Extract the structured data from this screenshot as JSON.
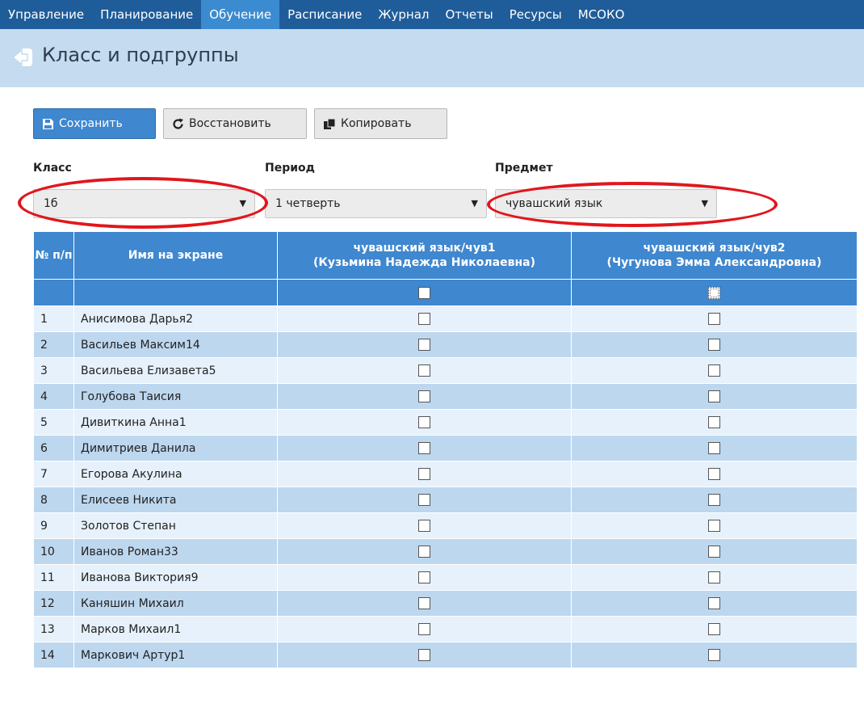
{
  "nav": {
    "items": [
      {
        "label": "Управление"
      },
      {
        "label": "Планирование"
      },
      {
        "label": "Обучение",
        "active": true
      },
      {
        "label": "Расписание"
      },
      {
        "label": "Журнал"
      },
      {
        "label": "Отчеты"
      },
      {
        "label": "Ресурсы"
      },
      {
        "label": "МСОКО"
      }
    ]
  },
  "header": {
    "title": "Класс и подгруппы",
    "back_icon": "arrow-left-icon"
  },
  "toolbar": {
    "save_label": "Сохранить",
    "restore_label": "Восстановить",
    "copy_label": "Копировать"
  },
  "filters": {
    "class": {
      "label": "Класс",
      "value": "1б"
    },
    "period": {
      "label": "Период",
      "value": "1 четверть"
    },
    "subject": {
      "label": "Предмет",
      "value": "чувашский язык"
    }
  },
  "table": {
    "col_num": "№ п/п",
    "col_name": "Имя на экране",
    "groups": [
      {
        "line1": "чувашский язык/чув1",
        "line2": "(Кузьмина Надежда Николаевна)"
      },
      {
        "line1": "чувашский язык/чув2",
        "line2": "(Чугунова Эмма Александровна)"
      }
    ],
    "rows": [
      {
        "num": "1",
        "name": "Анисимова Дарья2"
      },
      {
        "num": "2",
        "name": "Васильев Максим14"
      },
      {
        "num": "3",
        "name": "Васильева Елизавета5"
      },
      {
        "num": "4",
        "name": "Голубова Таисия"
      },
      {
        "num": "5",
        "name": "Дивиткина Анна1"
      },
      {
        "num": "6",
        "name": "Димитриев Данила"
      },
      {
        "num": "7",
        "name": "Егорова Акулина"
      },
      {
        "num": "8",
        "name": "Елисеев Никита"
      },
      {
        "num": "9",
        "name": "Золотов Степан"
      },
      {
        "num": "10",
        "name": "Иванов Роман33"
      },
      {
        "num": "11",
        "name": "Иванова Виктория9"
      },
      {
        "num": "12",
        "name": "Каняшин Михаил"
      },
      {
        "num": "13",
        "name": "Марков Михаил1"
      },
      {
        "num": "14",
        "name": "Маркович Артур1"
      }
    ]
  },
  "colors": {
    "nav_bg": "#1f5c9a",
    "nav_active": "#3b8bd0",
    "header_bg": "#c5dbef",
    "table_header": "#3f87cf",
    "row_light": "#e6f1fb",
    "row_dark": "#bdd7ef",
    "highlight": "#e0171d"
  }
}
